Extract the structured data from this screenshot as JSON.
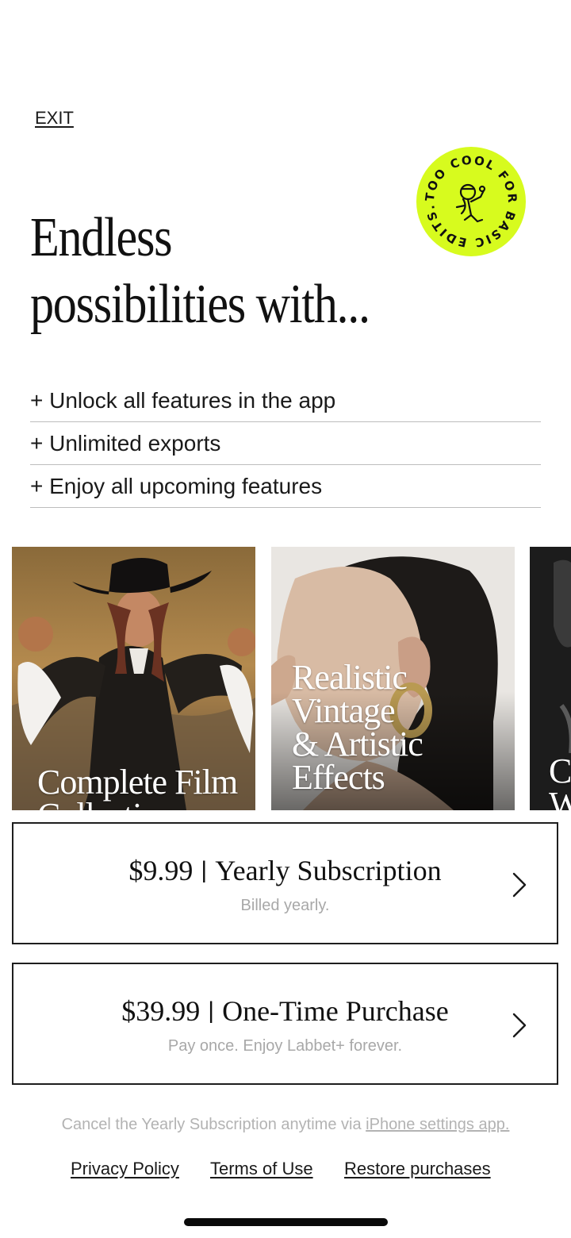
{
  "header": {
    "exit_label": "EXIT"
  },
  "badge": {
    "text": "TOO COOL FOR BASIC EDITS.",
    "icon": "cartoon-mascot-icon",
    "color": "#d7fb1e"
  },
  "headline": {
    "line1": "Endless",
    "line2": "possibilities with..."
  },
  "features": [
    "+ Unlock all features in the app",
    "+ Unlimited exports",
    "+ Enjoy all upcoming features"
  ],
  "carousel": [
    {
      "title": "Complete Film\nCollection"
    },
    {
      "title": "Realistic Vintage\n& Artistic Effects"
    },
    {
      "title": "Cl\nW"
    }
  ],
  "plans": [
    {
      "price": "$9.99",
      "separator": "|",
      "name": "Yearly Subscription",
      "note": "Billed yearly."
    },
    {
      "price": "$39.99",
      "separator": "|",
      "name": "One-Time Purchase",
      "note": "Pay once. Enjoy Labbet+ forever."
    }
  ],
  "footer": {
    "cancel_text": "Cancel the Yearly Subscription anytime via",
    "cancel_link": "iPhone settings app.",
    "privacy": "Privacy Policy",
    "terms": "Terms of Use",
    "restore": "Restore purchases"
  }
}
